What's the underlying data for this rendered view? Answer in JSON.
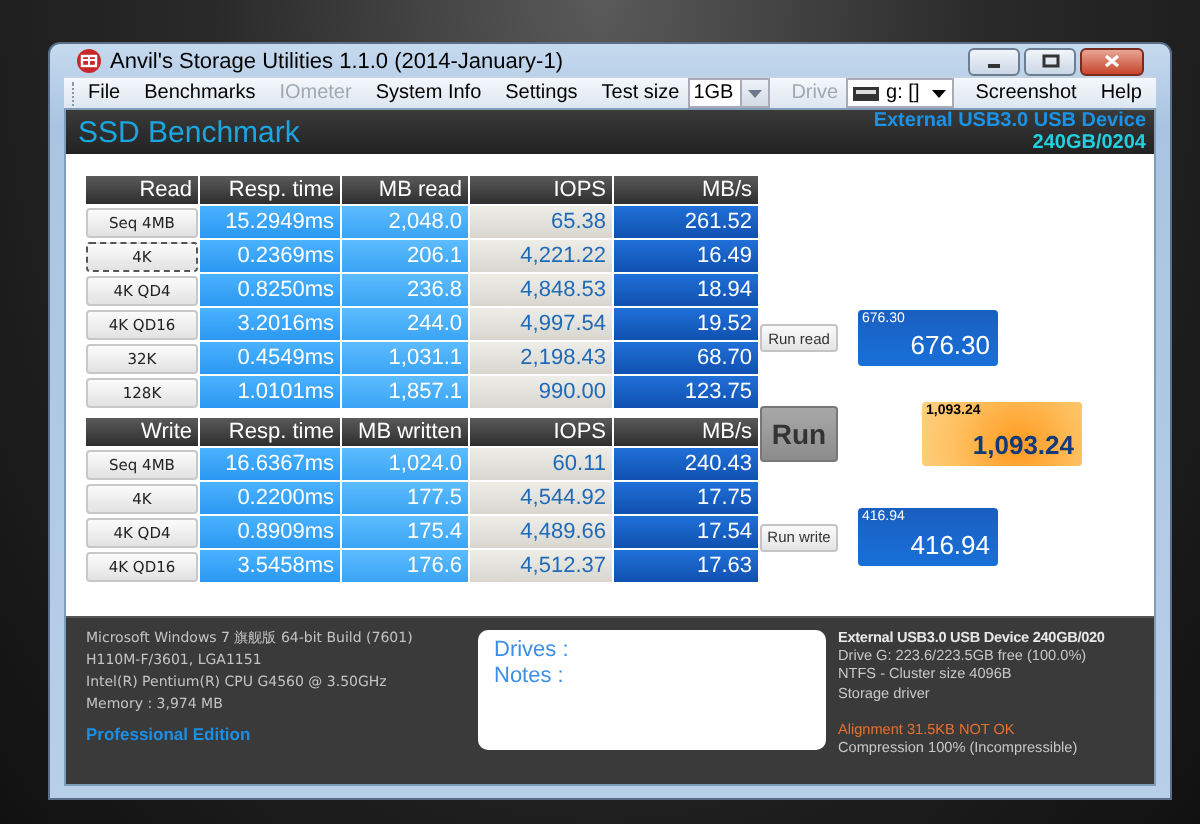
{
  "window": {
    "title": "Anvil's Storage Utilities 1.1.0 (2014-January-1)"
  },
  "menu": [
    {
      "kind": "item",
      "label": "File",
      "disabled": false
    },
    {
      "kind": "item",
      "label": "Benchmarks",
      "disabled": false
    },
    {
      "kind": "item",
      "label": "IOmeter",
      "disabled": true
    },
    {
      "kind": "item",
      "label": "System Info",
      "disabled": false
    },
    {
      "kind": "item",
      "label": "Settings",
      "disabled": false
    },
    {
      "kind": "label",
      "label": "Test size",
      "disabled": false
    },
    {
      "kind": "dropdown",
      "value": "1GB",
      "disabled": false
    },
    {
      "kind": "label",
      "label": "Drive",
      "disabled": true
    },
    {
      "kind": "drive_dropdown",
      "value": "g: []",
      "disabled": false
    },
    {
      "kind": "item",
      "label": "Screenshot",
      "disabled": false
    },
    {
      "kind": "item",
      "label": "Help",
      "disabled": false
    }
  ],
  "header": {
    "title": "SSD Benchmark",
    "device": "External USB3.0 USB Device",
    "capacity": "240GB/0204"
  },
  "read_table": {
    "columns": [
      "Read",
      "Resp. time",
      "MB read",
      "IOPS",
      "MB/s"
    ],
    "rows": [
      {
        "focused": false,
        "cells": [
          "Seq 4MB",
          "15.2949ms",
          "2,048.0",
          "65.38",
          "261.52"
        ]
      },
      {
        "focused": true,
        "cells": [
          "4K",
          "0.2369ms",
          "206.1",
          "4,221.22",
          "16.49"
        ]
      },
      {
        "focused": false,
        "cells": [
          "4K QD4",
          "0.8250ms",
          "236.8",
          "4,848.53",
          "18.94"
        ]
      },
      {
        "focused": false,
        "cells": [
          "4K QD16",
          "3.2016ms",
          "244.0",
          "4,997.54",
          "19.52"
        ]
      },
      {
        "focused": false,
        "cells": [
          "32K",
          "0.4549ms",
          "1,031.1",
          "2,198.43",
          "68.70"
        ]
      },
      {
        "focused": false,
        "cells": [
          "128K",
          "1.0101ms",
          "1,857.1",
          "990.00",
          "123.75"
        ]
      }
    ]
  },
  "write_table": {
    "columns": [
      "Write",
      "Resp. time",
      "MB written",
      "IOPS",
      "MB/s"
    ],
    "rows": [
      {
        "focused": false,
        "cells": [
          "Seq 4MB",
          "16.6367ms",
          "1,024.0",
          "60.11",
          "240.43"
        ]
      },
      {
        "focused": false,
        "cells": [
          "4K",
          "0.2200ms",
          "177.5",
          "4,544.92",
          "17.75"
        ]
      },
      {
        "focused": false,
        "cells": [
          "4K QD4",
          "0.8909ms",
          "175.4",
          "4,489.66",
          "17.54"
        ]
      },
      {
        "focused": false,
        "cells": [
          "4K QD16",
          "3.5458ms",
          "176.6",
          "4,512.37",
          "17.63"
        ]
      }
    ]
  },
  "scores": [
    {
      "kind": "read",
      "button": "Run read",
      "small": "676.30",
      "value": "676.30"
    },
    {
      "kind": "total",
      "button": "Run",
      "small": "1,093.24",
      "value": "1,093.24"
    },
    {
      "kind": "write",
      "button": "Run write",
      "small": "416.94",
      "value": "416.94"
    }
  ],
  "system_info": [
    "Microsoft Windows 7 旗舰版  64-bit Build (7601)",
    "H110M-F/3601, LGA1151",
    "Intel(R) Pentium(R) CPU G4560 @ 3.50GHz",
    "Memory : 3,974 MB"
  ],
  "edition": "Professional Edition",
  "notes": {
    "drives_label": "Drives :",
    "notes_label": "Notes :"
  },
  "drive_info": [
    {
      "kind": "title",
      "text": "External USB3.0 USB Device 240GB/020"
    },
    {
      "kind": "normal",
      "text": "Drive G: 223.6/223.5GB free (100.0%)"
    },
    {
      "kind": "normal",
      "text": "NTFS - Cluster size 4096B"
    },
    {
      "kind": "normal",
      "text": "Storage driver"
    },
    {
      "kind": "warning",
      "text": "Alignment 31.5KB NOT OK"
    },
    {
      "kind": "normal",
      "text": "Compression 100% (Incompressible)"
    }
  ]
}
